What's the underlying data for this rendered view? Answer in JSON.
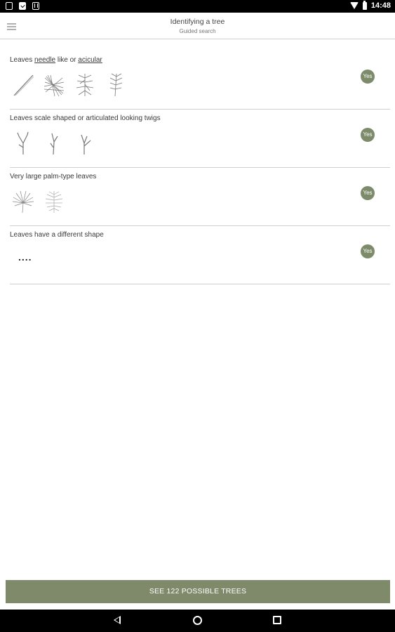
{
  "statusbar": {
    "time": "14:48"
  },
  "header": {
    "title": "Identifying a tree",
    "subtitle": "Guided search"
  },
  "options": [
    {
      "label_parts": [
        "Leaves ",
        "needle",
        " like or ",
        "acicular"
      ],
      "yes_label": "Yes",
      "thumb_icons": [
        "single-needle-icon",
        "needle-cluster-icon",
        "needle-branch-icon",
        "needle-sprig-icon"
      ]
    },
    {
      "label": "Leaves scale shaped or articulated looking twigs",
      "yes_label": "Yes",
      "thumb_icons": [
        "scale-twig-icon",
        "scale-twig-icon",
        "scale-twig-icon"
      ]
    },
    {
      "label": "Very large palm-type leaves",
      "yes_label": "Yes",
      "thumb_icons": [
        "fan-palm-icon",
        "feather-palm-icon"
      ]
    },
    {
      "label": "Leaves have a different shape",
      "yes_label": "Yes",
      "extra": "...."
    }
  ],
  "cta_label": "SEE 122 POSSIBLE TREES",
  "colors": {
    "accent": "#7f8a6b",
    "yes_badge": "#7d8b6a"
  }
}
